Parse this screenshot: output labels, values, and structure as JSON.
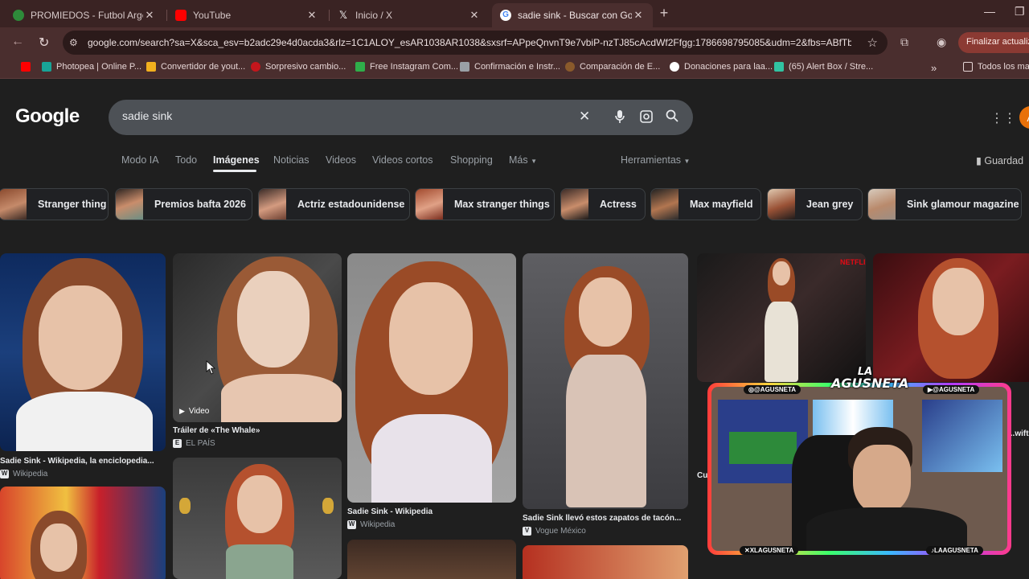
{
  "browser": {
    "tabs": [
      {
        "label": "PROMIEDOS - Futbol Argentina",
        "icon": "promiedos-icon",
        "color": "#2e8b3a"
      },
      {
        "label": "YouTube",
        "icon": "youtube-icon",
        "color": "#ff0000"
      },
      {
        "label": "Inicio / X",
        "icon": "x-icon",
        "color": "#111111"
      },
      {
        "label": "sadie sink - Buscar con Google",
        "icon": "google-icon",
        "color": "#ffffff"
      }
    ],
    "url": "google.com/search?sa=X&sca_esv=b2adc29e4d0acda3&rlz=1C1ALOY_esAR1038AR1038&sxsrf=APpeQnvnT9e7vbiP-nzTJ85cAcdWf2Ffgg:1786698795085&udm=2&fbs=ABfTbFUDa...",
    "update_button": "Finalizar actualiza",
    "bookmarks": [
      {
        "label": "",
        "icon": "youtube-icon",
        "color": "#ff0000"
      },
      {
        "label": "Photopea | Online P...",
        "icon": "photopea-icon",
        "color": "#18a497"
      },
      {
        "label": "Convertidor de yout...",
        "icon": "converter-icon",
        "color": "#f2b01e"
      },
      {
        "label": "Sorpresivo cambio...",
        "icon": "news-icon",
        "color": "#c4161c"
      },
      {
        "label": "Free Instagram Com...",
        "icon": "instagram-icon",
        "color": "#2fae4a"
      },
      {
        "label": "Confirmación e Instr...",
        "icon": "mail-icon",
        "color": "#9aa0a6"
      },
      {
        "label": "Comparación de E...",
        "icon": "compare-icon",
        "color": "#8a5a2b"
      },
      {
        "label": "Donaciones para laa...",
        "icon": "donation-icon",
        "color": "#ffffff"
      },
      {
        "label": "(65) Alert Box / Stre...",
        "icon": "streamlabs-icon",
        "color": "#31c3a2"
      }
    ],
    "bookmarks_all": "Todos los mar"
  },
  "google": {
    "logo": "Google",
    "query": "sadie sink",
    "tabs": [
      "Modo IA",
      "Todo",
      "Imágenes",
      "Noticias",
      "Videos",
      "Videos cortos",
      "Shopping",
      "Más"
    ],
    "active_tab": "Imágenes",
    "tools": "Herramientas",
    "saved": "Guardad",
    "avatar_letter": "A",
    "chips": [
      "Stranger thing",
      "Premios bafta 2026",
      "Actriz estadounidense",
      "Max stranger things",
      "Actress",
      "Max mayfield",
      "Jean grey",
      "Sink glamour magazine"
    ],
    "results": [
      {
        "caption": "Sadie Sink - Wikipedia, la enciclopedia...",
        "source": "Wikipedia",
        "source_icon": "W"
      },
      {
        "caption": "Tráiler de «The Whale»",
        "source": "EL PAÍS",
        "source_icon": "E",
        "badge": "Video"
      },
      {
        "caption": "Sadie Sink - Wikipedia",
        "source": "Wikipedia",
        "source_icon": "W"
      },
      {
        "caption": "Sadie Sink llevó estos zapatos de tacón...",
        "source": "Vogue México",
        "source_icon": "V"
      },
      {
        "caption": "Cu",
        "source": "",
        "source_icon": ""
      },
      {
        "caption": "...wift...",
        "source": "",
        "source_icon": ""
      }
    ]
  },
  "overlay": {
    "top_left_handle": "@AGUSNETA",
    "top_right_handle": "@AGUSNETA",
    "bottom_left_handle": "XLAGUSNETA",
    "bottom_right_handle": "LAAGUSNETA",
    "logo_line1": "LA",
    "logo_line2": "AGUSNETA"
  }
}
